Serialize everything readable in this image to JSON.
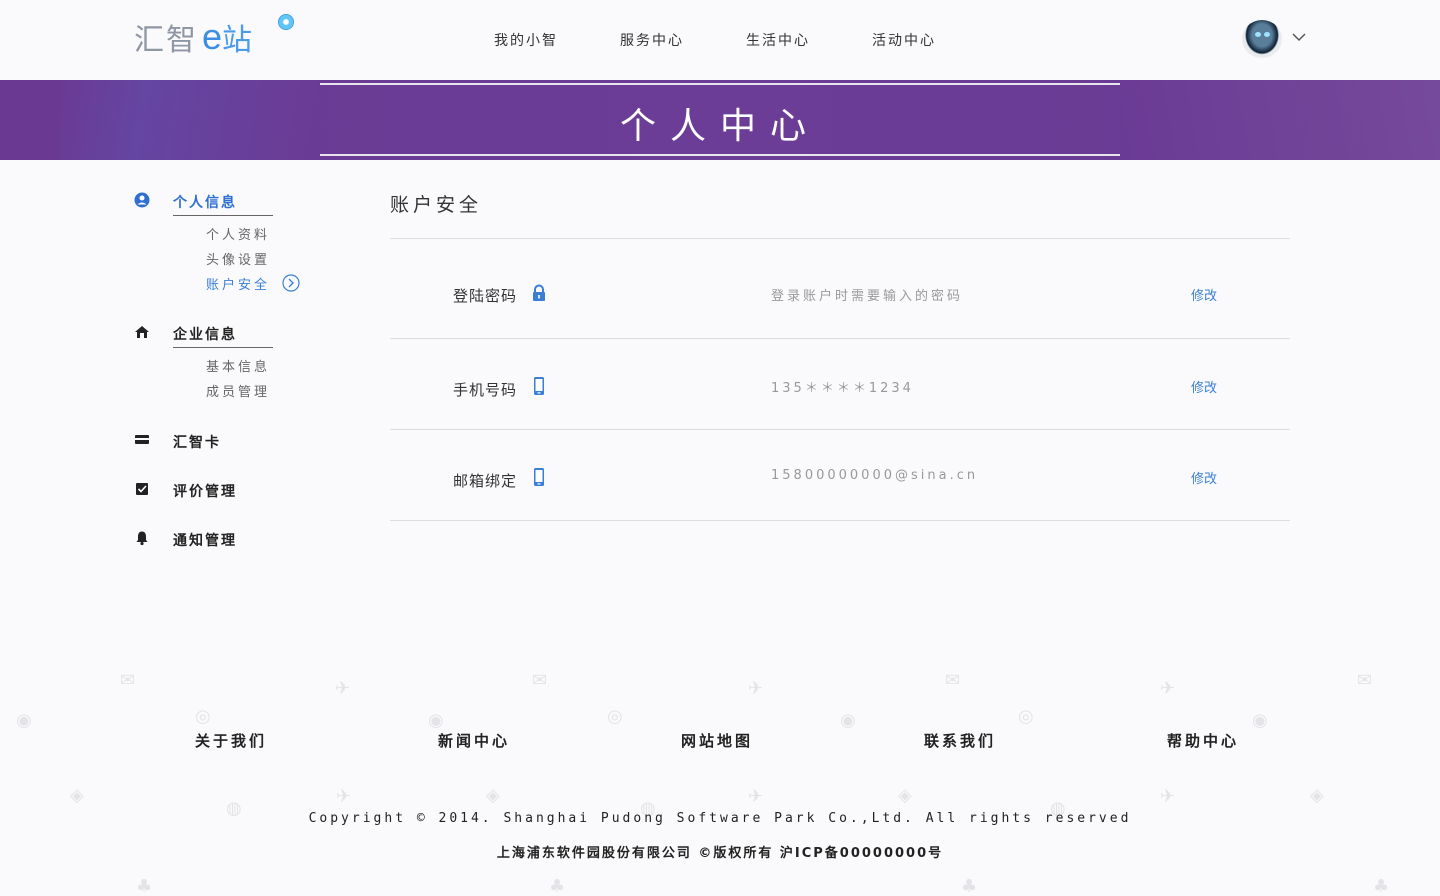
{
  "header": {
    "logo_text_1": "汇智",
    "logo_text_2": "e",
    "logo_text_3": "站",
    "nav": [
      "我的小智",
      "服务中心",
      "生活中心",
      "活动中心"
    ]
  },
  "banner": {
    "title": "个人中心"
  },
  "sidebar": {
    "groups": [
      {
        "label": "个人信息",
        "icon": "user-circle-icon",
        "items": [
          "个人资料",
          "头像设置",
          "账户安全"
        ]
      },
      {
        "label": "企业信息",
        "icon": "home-icon",
        "items": [
          "基本信息",
          "成员管理"
        ]
      },
      {
        "label": "汇智卡",
        "icon": "card-icon",
        "items": []
      },
      {
        "label": "评价管理",
        "icon": "checkbox-icon",
        "items": []
      },
      {
        "label": "通知管理",
        "icon": "bell-icon",
        "items": []
      }
    ]
  },
  "main": {
    "title": "账户安全",
    "rows": [
      {
        "label": "登陆密码",
        "icon": "lock-icon",
        "desc": "登录账户时需要输入的密码",
        "action": "修改"
      },
      {
        "label": "手机号码",
        "icon": "phone-icon",
        "desc": "135＊＊＊＊1234",
        "action": "修改"
      },
      {
        "label": "邮箱绑定",
        "icon": "phone-icon",
        "desc": "15800000000@sina.cn",
        "action": "修改"
      }
    ]
  },
  "footer": {
    "links": [
      "关于我们",
      "新闻中心",
      "网站地图",
      "联系我们",
      "帮助中心"
    ],
    "copyright": "Copyright © 2014. Shanghai Pudong Software Park Co.,Ltd. All rights reserved",
    "company": "上海浦东软件园股份有限公司 ©版权所有 沪ICP备00000000号"
  },
  "colors": {
    "accent": "#3a7fd6",
    "banner": "#6b3d96"
  }
}
